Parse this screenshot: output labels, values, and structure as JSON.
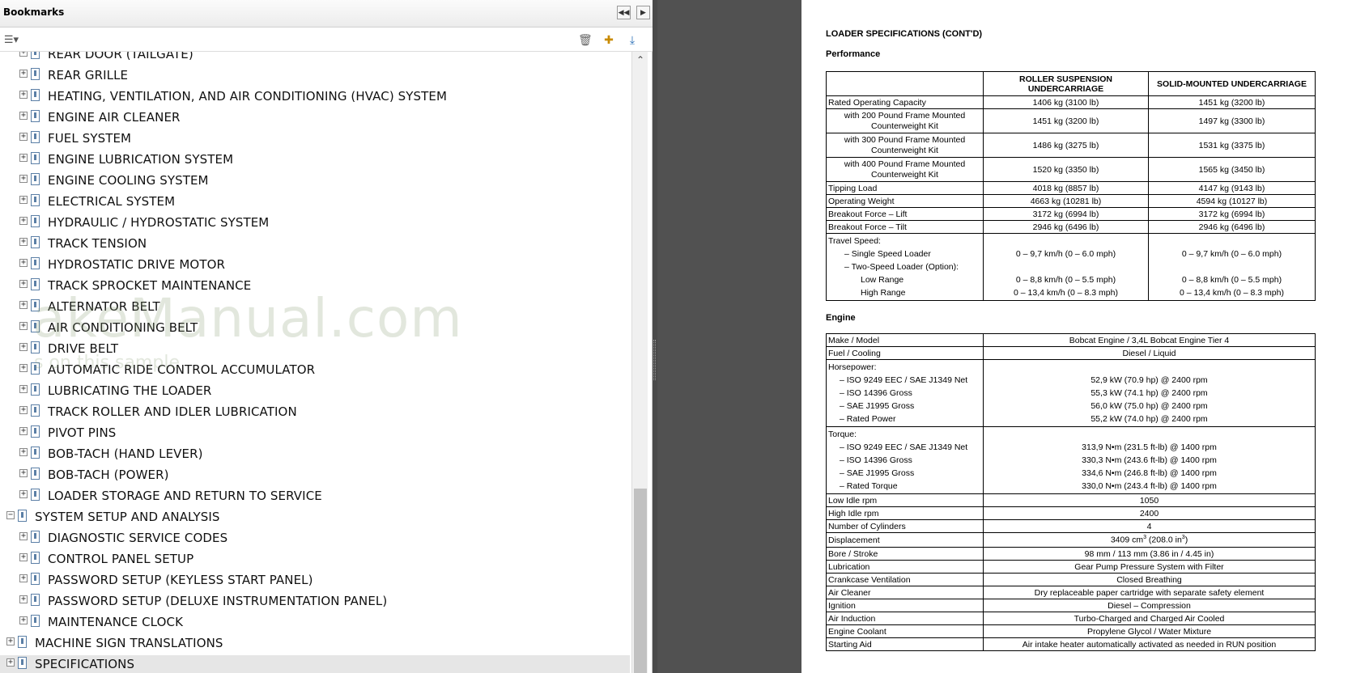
{
  "bookmarks": {
    "title": "Bookmarks",
    "items": [
      {
        "label": "REAR DOOR (TAILGATE)"
      },
      {
        "label": "REAR GRILLE"
      },
      {
        "label": "HEATING, VENTILATION, AND AIR CONDITIONING (HVAC) SYSTEM"
      },
      {
        "label": "ENGINE AIR CLEANER"
      },
      {
        "label": "FUEL SYSTEM"
      },
      {
        "label": "ENGINE LUBRICATION SYSTEM"
      },
      {
        "label": "ENGINE COOLING SYSTEM"
      },
      {
        "label": "ELECTRICAL SYSTEM"
      },
      {
        "label": "HYDRAULIC / HYDROSTATIC SYSTEM"
      },
      {
        "label": "TRACK TENSION"
      },
      {
        "label": "HYDROSTATIC DRIVE MOTOR"
      },
      {
        "label": "TRACK SPROCKET MAINTENANCE"
      },
      {
        "label": "ALTERNATOR BELT"
      },
      {
        "label": "AIR CONDITIONING BELT"
      },
      {
        "label": "DRIVE BELT"
      },
      {
        "label": "AUTOMATIC RIDE CONTROL ACCUMULATOR"
      },
      {
        "label": "LUBRICATING THE LOADER"
      },
      {
        "label": "TRACK ROLLER AND IDLER LUBRICATION"
      },
      {
        "label": "PIVOT PINS"
      },
      {
        "label": "BOB-TACH (HAND LEVER)"
      },
      {
        "label": "BOB-TACH (POWER)"
      },
      {
        "label": "LOADER STORAGE AND RETURN TO SERVICE"
      },
      {
        "label": "SYSTEM SETUP AND ANALYSIS"
      },
      {
        "label": "DIAGNOSTIC SERVICE CODES"
      },
      {
        "label": "CONTROL PANEL SETUP"
      },
      {
        "label": "PASSWORD SETUP (KEYLESS START PANEL)"
      },
      {
        "label": "PASSWORD SETUP (DELUXE INSTRUMENTATION PANEL)"
      },
      {
        "label": "MAINTENANCE CLOCK"
      },
      {
        "label": "MACHINE SIGN TRANSLATIONS"
      },
      {
        "label": "SPECIFICATIONS"
      }
    ],
    "watermark": {
      "line1": "akeManual.com",
      "line2": "s on this sample"
    }
  },
  "doc": {
    "page_title": "LOADER SPECIFICATIONS (CONT'D)",
    "performance": {
      "title": "Performance",
      "col1": "ROLLER SUSPENSION UNDERCARRIAGE",
      "col2": "SOLID-MOUNTED UNDERCARRIAGE",
      "rows": [
        {
          "label": "Rated Operating Capacity",
          "v1": "1406 kg (3100 lb)",
          "v2": "1451 kg (3200 lb)"
        },
        {
          "label": "with 200 Pound Frame Mounted Counterweight Kit",
          "v1": "1451 kg (3200 lb)",
          "v2": "1497 kg (3300 lb)"
        },
        {
          "label": "with 300 Pound Frame Mounted Counterweight Kit",
          "v1": "1486 kg (3275 lb)",
          "v2": "1531 kg (3375 lb)"
        },
        {
          "label": "with 400 Pound Frame Mounted Counterweight Kit",
          "v1": "1520 kg (3350 lb)",
          "v2": "1565 kg (3450 lb)"
        },
        {
          "label": "Tipping Load",
          "v1": "4018 kg (8857 lb)",
          "v2": "4147 kg (9143 lb)"
        },
        {
          "label": "Operating Weight",
          "v1": "4663 kg (10281 lb)",
          "v2": "4594 kg (10127 lb)"
        },
        {
          "label": "Breakout Force – Lift",
          "v1": "3172 kg (6994 lb)",
          "v2": "3172 kg (6994 lb)"
        },
        {
          "label": "Breakout Force – Tilt",
          "v1": "2946 kg (6496 lb)",
          "v2": "2946 kg (6496 lb)"
        }
      ],
      "travel": {
        "label": "Travel Speed:",
        "single": {
          "label": "– Single Speed Loader",
          "v1": "0 – 9,7 km/h (0 – 6.0 mph)",
          "v2": "0 – 9,7 km/h (0 – 6.0 mph)"
        },
        "two": {
          "label": "– Two-Speed Loader (Option):"
        },
        "low": {
          "label": "Low Range",
          "v1": "0 – 8,8 km/h (0 – 5.5 mph)",
          "v2": "0 – 8,8 km/h (0 – 5.5 mph)"
        },
        "high": {
          "label": "High Range",
          "v1": "0 – 13,4 km/h (0 – 8.3 mph)",
          "v2": "0 – 13,4 km/h (0 – 8.3 mph)"
        }
      }
    },
    "engine": {
      "title": "Engine",
      "make": {
        "label": "Make / Model",
        "value": "Bobcat Engine / 3,4L Bobcat Engine Tier 4"
      },
      "fuel": {
        "label": "Fuel / Cooling",
        "value": "Diesel / Liquid"
      },
      "horsepower": {
        "label": "Horsepower:",
        "rows": [
          {
            "label": "– ISO 9249 EEC / SAE J1349 Net",
            "value": "52,9 kW (70.9 hp) @ 2400 rpm"
          },
          {
            "label": "– ISO 14396 Gross",
            "value": "55,3 kW (74.1 hp) @ 2400 rpm"
          },
          {
            "label": "– SAE J1995 Gross",
            "value": "56,0 kW (75.0 hp) @ 2400 rpm"
          },
          {
            "label": "– Rated Power",
            "value": "55,2 kW (74.0 hp) @ 2400 rpm"
          }
        ]
      },
      "torque": {
        "label": "Torque:",
        "rows": [
          {
            "label": "– ISO 9249 EEC / SAE J1349 Net",
            "value": "313,9 N•m (231.5 ft-lb) @ 1400 rpm"
          },
          {
            "label": "– ISO 14396 Gross",
            "value": "330,3 N•m (243.6 ft-lb) @ 1400 rpm"
          },
          {
            "label": "– SAE J1995 Gross",
            "value": "334,6 N•m (246.8 ft-lb) @ 1400 rpm"
          },
          {
            "label": "– Rated Torque",
            "value": "330,0 N•m (243.4 ft-lb) @ 1400 rpm"
          }
        ]
      },
      "rows": [
        {
          "label": "Low Idle rpm",
          "value": "1050"
        },
        {
          "label": "High Idle rpm",
          "value": "2400"
        },
        {
          "label": "Number of Cylinders",
          "value": "4"
        }
      ],
      "displacement": {
        "label": "Displacement",
        "value_a": "3409 cm",
        "sup_a": "3",
        "value_b": " (208.0 in",
        "sup_b": "3",
        "value_c": ")"
      },
      "rows2": [
        {
          "label": "Bore / Stroke",
          "value": "98 mm / 113 mm (3.86 in / 4.45 in)"
        },
        {
          "label": "Lubrication",
          "value": "Gear Pump Pressure System with Filter"
        },
        {
          "label": "Crankcase Ventilation",
          "value": "Closed Breathing"
        },
        {
          "label": "Air Cleaner",
          "value": "Dry replaceable paper cartridge with separate safety element"
        },
        {
          "label": "Ignition",
          "value": "Diesel – Compression"
        },
        {
          "label": "Air Induction",
          "value": "Turbo-Charged and Charged Air Cooled"
        },
        {
          "label": "Engine Coolant",
          "value": "Propylene Glycol / Water Mixture"
        },
        {
          "label": "Starting Aid",
          "value": "Air intake heater automatically activated as needed in RUN position"
        }
      ]
    }
  }
}
